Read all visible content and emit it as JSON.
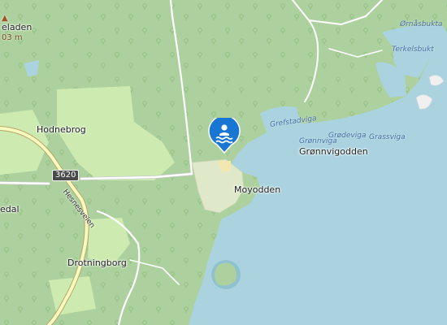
{
  "map": {
    "labels": {
      "hodnebrog": "Hodnebrog",
      "moyodden": "Moyodden",
      "gronnvigodden": "Grønnvigodden",
      "drotningborg": "Drotningborg",
      "edal": "edal",
      "hesnesveien": "Hesnesveien",
      "eladen": "eladen",
      "elevation": "03 m",
      "grefstadviga": "Grefstadviga",
      "gronnviga": "Grønnviga",
      "grodeviga": "Grødeviga",
      "grassviga": "Grassviga",
      "ornasbukta": "Ørnåsbukta",
      "terkelsbukt": "Terkelsbukt"
    },
    "road_ref": "3620",
    "marker": {
      "icon": "swimming-icon",
      "color": "#1976d2"
    },
    "colors": {
      "water": "#aad3df",
      "forest": "#add19e",
      "grass": "#cdebb0",
      "residential": "#e0dfdf",
      "road": "#f7fabf"
    }
  }
}
